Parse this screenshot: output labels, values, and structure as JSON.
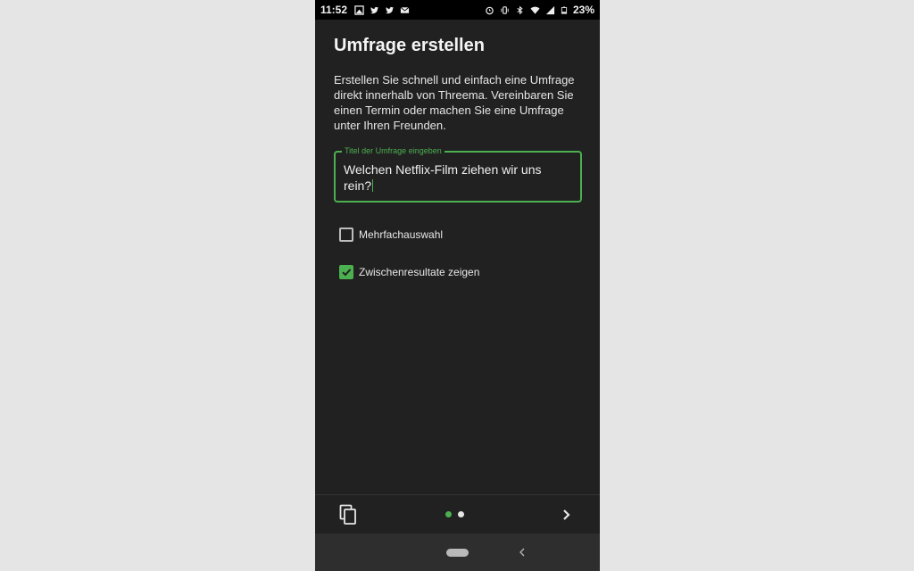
{
  "status_bar": {
    "time": "11:52",
    "battery": "23%",
    "icons_left": [
      "gallery-icon",
      "twitter-icon",
      "twitter-icon",
      "mail-icon"
    ],
    "icons_right": [
      "alarm-icon",
      "vibrate-icon",
      "bluetooth-icon",
      "wifi-icon",
      "signal-icon",
      "battery-icon"
    ]
  },
  "page": {
    "title": "Umfrage erstellen",
    "intro": "Erstellen Sie schnell und einfach eine Umfrage direkt innerhalb von Threema. Vereinbaren Sie einen Termin oder machen Sie eine Umfrage unter Ihren Freunden."
  },
  "title_input": {
    "label": "Titel der Umfrage eingeben",
    "value": "Welchen Netflix-Film ziehen wir uns rein?"
  },
  "options": {
    "multiple_choice": {
      "label": "Mehrfachauswahl",
      "checked": false
    },
    "show_intermediate": {
      "label": "Zwischenresultate zeigen",
      "checked": true
    }
  },
  "pager": {
    "total": 2,
    "current": 1
  },
  "colors": {
    "accent": "#4caf50",
    "background": "#212121",
    "statusbar": "#000000",
    "navbar": "#2e2e2e"
  }
}
